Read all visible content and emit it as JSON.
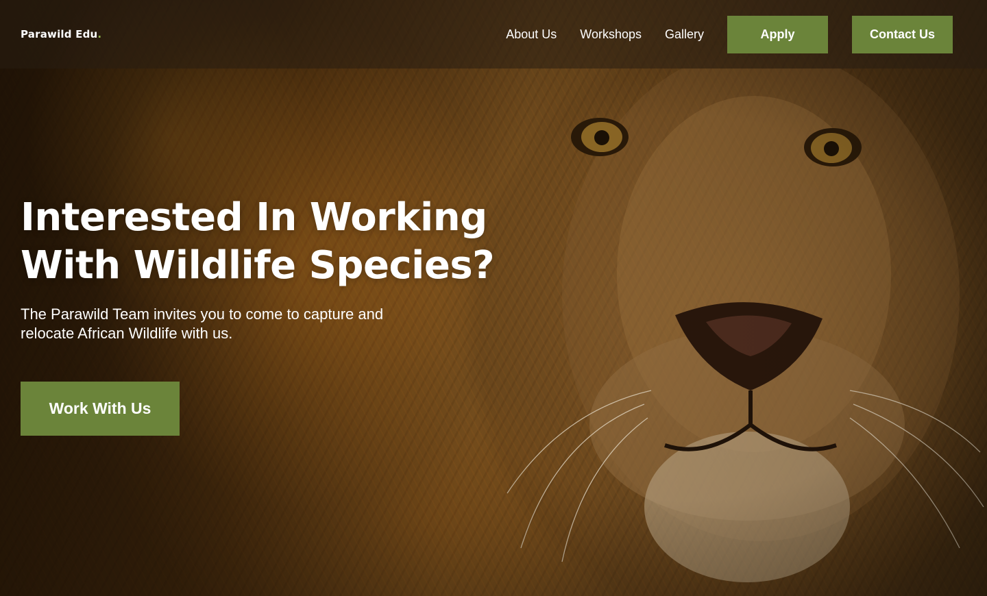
{
  "brand": {
    "name": "Parawild Edu",
    "dot": ".",
    "accent_color": "#8fb34a"
  },
  "nav": {
    "links": [
      "About Us",
      "Workshops",
      "Gallery"
    ],
    "apply_label": "Apply",
    "contact_label": "Contact Us",
    "button_color": "#6b843a"
  },
  "hero": {
    "title_line1": "Interested In Working",
    "title_line2": "With Wildlife Species?",
    "subtitle": "The Parawild Team invites you to come to capture and relocate African Wildlife with us.",
    "cta_label": "Work With Us",
    "background_image": "lion-portrait"
  }
}
